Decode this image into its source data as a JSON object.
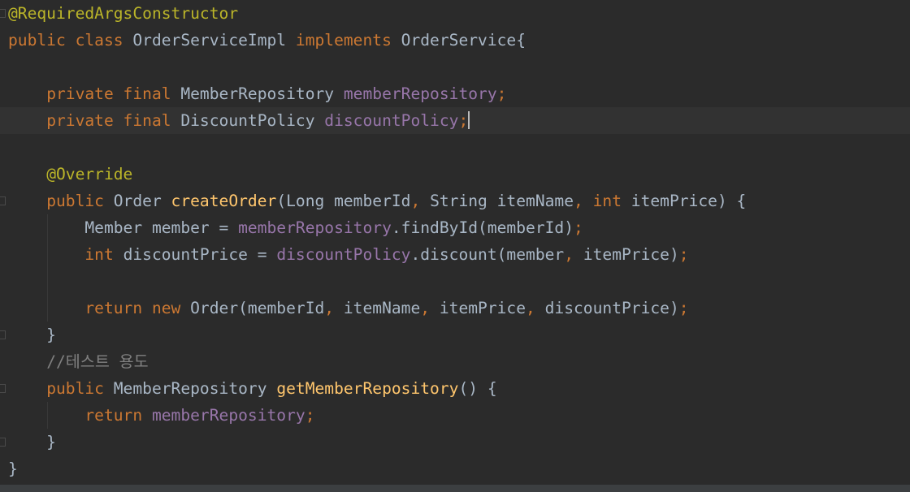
{
  "editor": {
    "caret_line": 5,
    "lines": [
      {
        "tokens": [
          {
            "t": "@RequiredArgsConstructor",
            "c": "annotation"
          }
        ]
      },
      {
        "tokens": [
          {
            "t": "public class ",
            "c": "keyword"
          },
          {
            "t": "OrderServiceImpl ",
            "c": "plain"
          },
          {
            "t": "implements ",
            "c": "keyword"
          },
          {
            "t": "OrderService{",
            "c": "plain"
          }
        ]
      },
      {
        "tokens": []
      },
      {
        "tokens": [
          {
            "t": "    ",
            "c": "plain"
          },
          {
            "t": "private final ",
            "c": "keyword"
          },
          {
            "t": "MemberRepository ",
            "c": "plain"
          },
          {
            "t": "memberRepository",
            "c": "field"
          },
          {
            "t": ";",
            "c": "punct"
          }
        ]
      },
      {
        "tokens": [
          {
            "t": "    ",
            "c": "plain"
          },
          {
            "t": "private final ",
            "c": "keyword"
          },
          {
            "t": "DiscountPolicy ",
            "c": "plain"
          },
          {
            "t": "discountPolicy",
            "c": "field"
          },
          {
            "t": ";",
            "c": "punct"
          }
        ]
      },
      {
        "tokens": []
      },
      {
        "tokens": [
          {
            "t": "    ",
            "c": "plain"
          },
          {
            "t": "@Override",
            "c": "annotation"
          }
        ]
      },
      {
        "tokens": [
          {
            "t": "    ",
            "c": "plain"
          },
          {
            "t": "public ",
            "c": "keyword"
          },
          {
            "t": "Order ",
            "c": "plain"
          },
          {
            "t": "createOrder",
            "c": "method-decl"
          },
          {
            "t": "(Long memberId",
            "c": "plain"
          },
          {
            "t": ", ",
            "c": "punct"
          },
          {
            "t": "String itemName",
            "c": "plain"
          },
          {
            "t": ", ",
            "c": "punct"
          },
          {
            "t": "int ",
            "c": "keyword"
          },
          {
            "t": "itemPrice) {",
            "c": "plain"
          }
        ]
      },
      {
        "tokens": [
          {
            "t": "        Member member = ",
            "c": "plain"
          },
          {
            "t": "memberRepository",
            "c": "field"
          },
          {
            "t": ".findById(memberId)",
            "c": "plain"
          },
          {
            "t": ";",
            "c": "punct"
          }
        ]
      },
      {
        "tokens": [
          {
            "t": "        ",
            "c": "plain"
          },
          {
            "t": "int ",
            "c": "keyword"
          },
          {
            "t": "discountPrice = ",
            "c": "plain"
          },
          {
            "t": "discountPolicy",
            "c": "field"
          },
          {
            "t": ".discount(member",
            "c": "plain"
          },
          {
            "t": ", ",
            "c": "punct"
          },
          {
            "t": "itemPrice)",
            "c": "plain"
          },
          {
            "t": ";",
            "c": "punct"
          }
        ]
      },
      {
        "tokens": []
      },
      {
        "tokens": [
          {
            "t": "        ",
            "c": "plain"
          },
          {
            "t": "return new ",
            "c": "keyword"
          },
          {
            "t": "Order(memberId",
            "c": "plain"
          },
          {
            "t": ", ",
            "c": "punct"
          },
          {
            "t": "itemName",
            "c": "plain"
          },
          {
            "t": ", ",
            "c": "punct"
          },
          {
            "t": "itemPrice",
            "c": "plain"
          },
          {
            "t": ", ",
            "c": "punct"
          },
          {
            "t": "discountPrice)",
            "c": "plain"
          },
          {
            "t": ";",
            "c": "punct"
          }
        ]
      },
      {
        "tokens": [
          {
            "t": "    }",
            "c": "plain"
          }
        ]
      },
      {
        "tokens": [
          {
            "t": "    ",
            "c": "plain"
          },
          {
            "t": "//테스트 용도",
            "c": "comment"
          }
        ]
      },
      {
        "tokens": [
          {
            "t": "    ",
            "c": "plain"
          },
          {
            "t": "public ",
            "c": "keyword"
          },
          {
            "t": "MemberRepository ",
            "c": "plain"
          },
          {
            "t": "getMemberRepository",
            "c": "method-decl"
          },
          {
            "t": "() {",
            "c": "plain"
          }
        ]
      },
      {
        "tokens": [
          {
            "t": "        ",
            "c": "plain"
          },
          {
            "t": "return ",
            "c": "keyword"
          },
          {
            "t": "memberRepository",
            "c": "field"
          },
          {
            "t": ";",
            "c": "punct"
          }
        ]
      },
      {
        "tokens": [
          {
            "t": "    }",
            "c": "plain"
          }
        ]
      },
      {
        "tokens": [
          {
            "t": "}",
            "c": "plain"
          }
        ]
      }
    ]
  }
}
